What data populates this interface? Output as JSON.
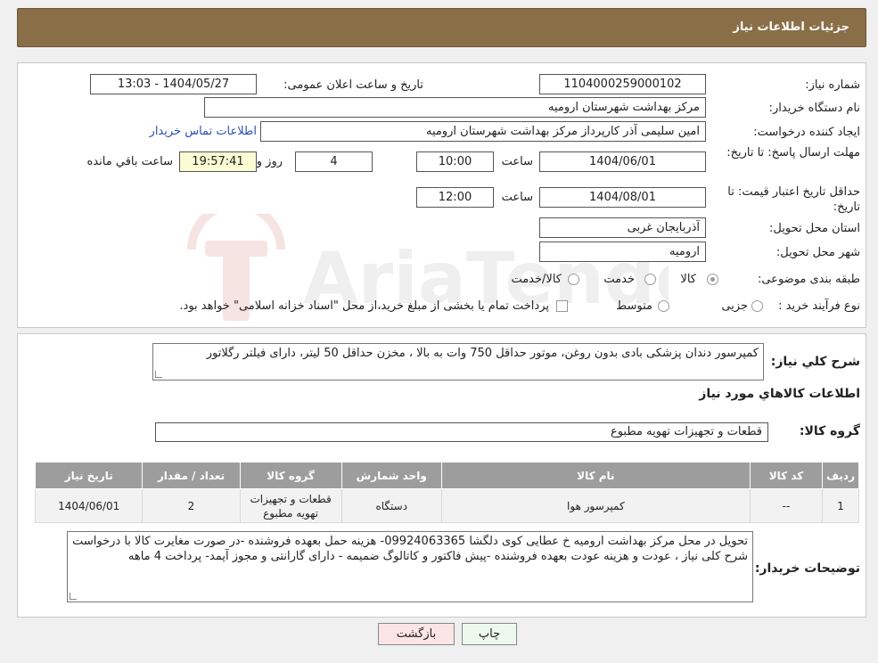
{
  "header": {
    "title": "جزئیات اطلاعات نیاز"
  },
  "watermark": {
    "text": "AriaTender.neT"
  },
  "form": {
    "need_number_label": "شماره نیاز:",
    "need_number": "1104000259000102",
    "announce_label": "تاریخ و ساعت اعلان عمومی:",
    "announce_value": "1404/05/27 - 13:03",
    "buyer_org_label": "نام دستگاه خریدار:",
    "buyer_org": "مرکز بهداشت شهرستان ارومیه",
    "requester_label": "ایجاد کننده درخواست:",
    "requester": "امین سلیمی آذر کارپرداز مرکز بهداشت شهرستان ارومیه",
    "contact_link": "اطلاعات تماس خریدار",
    "deadline_label": "مهلت ارسال پاسخ: تا تاریخ:",
    "deadline_date": "1404/06/01",
    "time_label": "ساعت",
    "deadline_time": "10:00",
    "days_value": "4",
    "days_label": "روز و",
    "remaining_time": "19:57:41",
    "remaining_label": "ساعت باقي مانده",
    "validity_label": "حداقل تاریخ اعتبار قیمت: تا تاریخ:",
    "validity_date": "1404/08/01",
    "validity_time": "12:00",
    "province_label": "استان محل تحویل:",
    "province": "آذربایجان غربی",
    "city_label": "شهر محل تحویل:",
    "city": "ارومیه",
    "category_label": "طبقه بندی موضوعی:",
    "category_options": [
      "کالا",
      "خدمت",
      "کالا/خدمت"
    ],
    "process_label": "نوع فرآیند خرید :",
    "process_options": [
      "جزیی",
      "متوسط"
    ],
    "process_note": "پرداخت تمام یا بخشی از مبلغ خرید،از محل \"اسناد خزانه اسلامی\" خواهد بود."
  },
  "details": {
    "summary_label": "شرح کلي نياز:",
    "summary_text": "کمپرسور دندان پزشکی بادی بدون روغن، موتور حداقل 750 وات به بالا ، مخزن حداقل 50 لیتر، دارای فیلتر رگلاتور",
    "goods_info_title": "اطلاعات کالاهاي مورد نياز",
    "goods_group_label": "گروه کالا:",
    "goods_group": "قطعات و تجهیزات تهویه مطبوع",
    "table": {
      "headers": [
        "رديف",
        "کد کالا",
        "نام کالا",
        "واحد شمارش",
        "گروه کالا",
        "تعداد / مقدار",
        "تاريخ نياز"
      ],
      "rows": [
        [
          "1",
          "--",
          "کمپرسور هوا",
          "دستگاه",
          "قطعات و تجهیزات تهویه مطبوع",
          "2",
          "1404/06/01"
        ]
      ]
    },
    "buyer_notes_label": "توضیحات خریدار:",
    "buyer_notes": "تحویل در محل مرکز بهداشت ارومیه خ عطایی کوی دلگشا 09924063365- هزینه حمل بعهده فروشنده -در صورت مغایرت کالا با درخواست شرح کلی نیاز ، عودت و هزینه عودت بعهده فروشنده -پیش فاکتور و کاتالوگ ضمیمه -   دارای گارانتی و مجوز آیمد- پرداخت 4 ماهه"
  },
  "buttons": {
    "print": "چاپ",
    "back": "بازگشت"
  }
}
